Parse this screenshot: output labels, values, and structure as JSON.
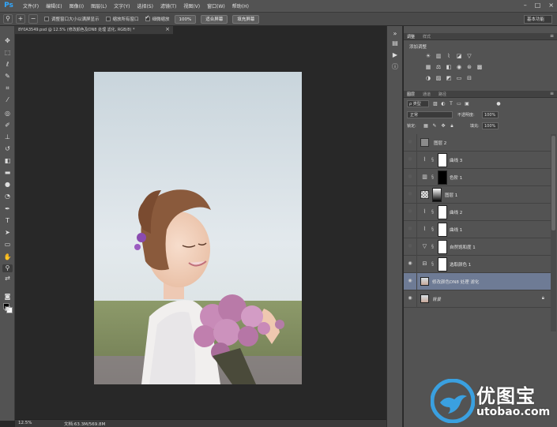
{
  "app": {
    "logo": "Ps"
  },
  "menu": [
    "文件(F)",
    "编辑(E)",
    "图像(I)",
    "图层(L)",
    "文字(Y)",
    "选择(S)",
    "滤镜(T)",
    "视图(V)",
    "窗口(W)",
    "帮助(H)"
  ],
  "window_controls": [
    "–",
    "□",
    "×"
  ],
  "options_bar": {
    "resize_windows": "调整窗口大小以满屏显示",
    "zoom_all_windows": "缩放所有窗口",
    "scrubby_zoom": "细微缩放",
    "btn_100": "100%",
    "btn_fit": "适合屏幕",
    "btn_fill": "填充屏幕",
    "workspace": "基本功能"
  },
  "document": {
    "tab_title": "8Y0A3549.psd @ 12.5% (修改颜色及DN8 处理 滤化, RGB/8) *",
    "zoom": "12.5%",
    "doc_size": "文档:63.3M/569.8M"
  },
  "adjustments_panel": {
    "tabs": [
      "调整",
      "样式"
    ],
    "title": "添加调整",
    "icons": [
      "brightness-icon",
      "levels-icon",
      "curves-icon",
      "exposure-icon",
      "vibrance-icon",
      "hue-sat-icon",
      "color-balance-icon",
      "bw-icon",
      "photo-filter-icon",
      "channel-mixer-icon",
      "color-lookup-icon",
      "invert-icon",
      "posterize-icon",
      "threshold-icon",
      "gradient-map-icon",
      "selective-color-icon"
    ]
  },
  "layers_panel": {
    "tabs": [
      "图层",
      "通道",
      "路径"
    ],
    "filter": "ρ 类型",
    "blend_mode": "正常",
    "opacity_label": "不透明度:",
    "opacity": "100%",
    "lock_label": "锁定:",
    "fill_label": "填充:",
    "fill": "100%",
    "layers": [
      {
        "name": "图层 2",
        "visible": false,
        "type": "gray"
      },
      {
        "name": "曲线 3",
        "visible": false,
        "type": "curves"
      },
      {
        "name": "色阶 1",
        "visible": false,
        "type": "levels"
      },
      {
        "name": "图层 1",
        "visible": false,
        "type": "checker"
      },
      {
        "name": "曲线 2",
        "visible": false,
        "type": "curves"
      },
      {
        "name": "曲线 1",
        "visible": false,
        "type": "curves"
      },
      {
        "name": "自然饱和度 1",
        "visible": false,
        "type": "vibrance"
      },
      {
        "name": "选取颜色 1",
        "visible": true,
        "type": "selective"
      },
      {
        "name": "修改颜色DN8 处理 滤化",
        "visible": true,
        "type": "photo",
        "selected": true
      },
      {
        "name": "背景",
        "visible": true,
        "type": "photo",
        "locked": true
      }
    ]
  },
  "watermark": {
    "text": "优图宝",
    "url": "utobao.com"
  },
  "colors": {
    "accent": "#31a8ff",
    "selected_layer": "#6e7b95"
  }
}
